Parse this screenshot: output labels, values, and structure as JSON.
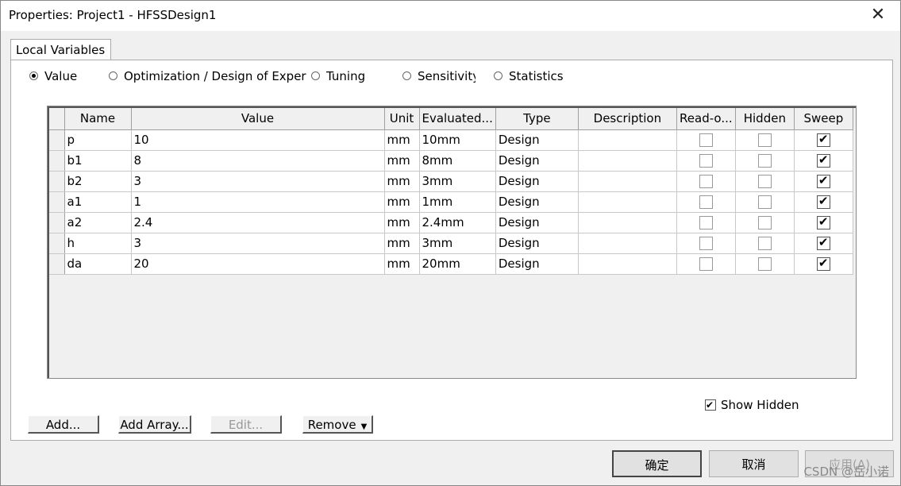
{
  "window": {
    "title": "Properties: Project1 - HFSSDesign1",
    "close_glyph": "✕"
  },
  "tabs": [
    {
      "label": "Local Variables",
      "active": true
    }
  ],
  "radios": [
    {
      "label": "Value",
      "selected": true
    },
    {
      "label": "Optimization / Design of Exper",
      "selected": false
    },
    {
      "label": "Tuning",
      "selected": false
    },
    {
      "label": "Sensitivity",
      "selected": false
    },
    {
      "label": "Statistics",
      "selected": false
    }
  ],
  "table": {
    "columns": [
      "Name",
      "Value",
      "Unit",
      "Evaluated...",
      "Type",
      "Description",
      "Read-o...",
      "Hidden",
      "Sweep"
    ],
    "rows": [
      {
        "name": "p",
        "value": "10",
        "unit": "mm",
        "evaluated": "10mm",
        "type": "Design",
        "description": "",
        "readonly": false,
        "hidden": false,
        "sweep": true
      },
      {
        "name": "b1",
        "value": "8",
        "unit": "mm",
        "evaluated": "8mm",
        "type": "Design",
        "description": "",
        "readonly": false,
        "hidden": false,
        "sweep": true
      },
      {
        "name": "b2",
        "value": "3",
        "unit": "mm",
        "evaluated": "3mm",
        "type": "Design",
        "description": "",
        "readonly": false,
        "hidden": false,
        "sweep": true
      },
      {
        "name": "a1",
        "value": "1",
        "unit": "mm",
        "evaluated": "1mm",
        "type": "Design",
        "description": "",
        "readonly": false,
        "hidden": false,
        "sweep": true
      },
      {
        "name": "a2",
        "value": "2.4",
        "unit": "mm",
        "evaluated": "2.4mm",
        "type": "Design",
        "description": "",
        "readonly": false,
        "hidden": false,
        "sweep": true
      },
      {
        "name": "h",
        "value": "3",
        "unit": "mm",
        "evaluated": "3mm",
        "type": "Design",
        "description": "",
        "readonly": false,
        "hidden": false,
        "sweep": true
      },
      {
        "name": "da",
        "value": "20",
        "unit": "mm",
        "evaluated": "20mm",
        "type": "Design",
        "description": "",
        "readonly": false,
        "hidden": false,
        "sweep": true
      }
    ]
  },
  "show_hidden": {
    "label": "Show Hidden",
    "checked": true
  },
  "buttons": {
    "add": "Add...",
    "add_array": "Add Array...",
    "edit": "Edit...",
    "remove": "Remove"
  },
  "footer": {
    "ok": "确定",
    "cancel": "取消",
    "apply": "应用(A)"
  },
  "watermark": "CSDN @岳小诺"
}
